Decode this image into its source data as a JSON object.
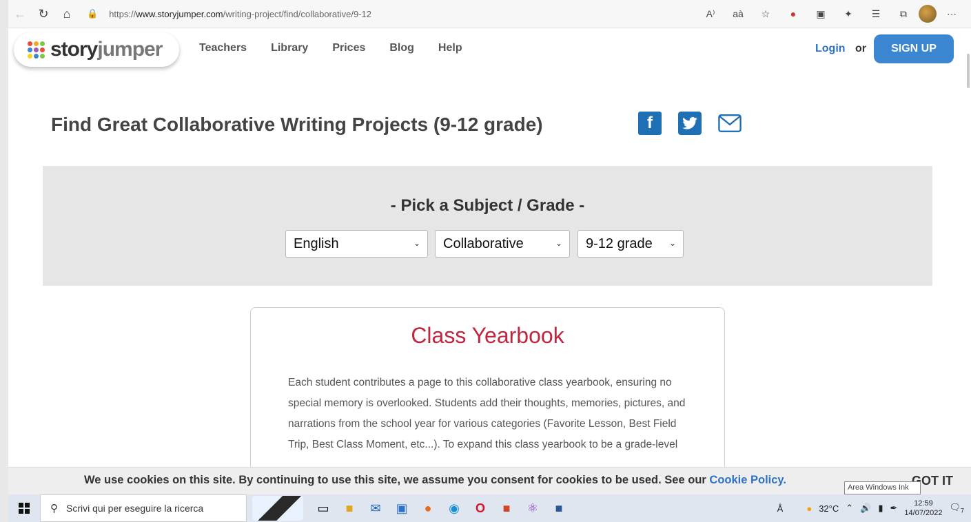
{
  "browser": {
    "url_prefix": "https://",
    "url_host": "www.storyjumper.com",
    "url_path": "/writing-project/find/collaborative/9-12",
    "read_aloud_label": "A⁾",
    "translate_label": "aà"
  },
  "nav": {
    "logo_story": "story",
    "logo_jumper": "jumper",
    "links": [
      "Teachers",
      "Library",
      "Prices",
      "Blog",
      "Help"
    ],
    "login": "Login",
    "or": "or",
    "signup": "SIGN UP"
  },
  "page": {
    "title": "Find Great Collaborative Writing Projects (9-12 grade)",
    "share_facebook": "f"
  },
  "picker": {
    "heading": "- Pick a Subject / Grade -",
    "subject": "English",
    "type": "Collaborative",
    "grade": "9-12 grade"
  },
  "card": {
    "title": "Class Yearbook",
    "description": "Each student contributes a page to this collaborative class yearbook, ensuring no special memory is overlooked. Students add their thoughts, memories, pictures, and narrations from the school year for various categories (Favorite Lesson, Best Field Trip, Best Class Moment, etc...). To expand this class yearbook to be a grade-level"
  },
  "cookie": {
    "message": "We use cookies on this site. By continuing to use this site, we assume you consent for cookies to be used. See our ",
    "policy_link": "Cookie Policy.",
    "got_it": "GOT IT",
    "tooltip": "Area Windows Ink"
  },
  "taskbar": {
    "search_placeholder": "Scrivi qui per eseguire la ricerca",
    "weather": "32°C",
    "time": "12:59",
    "date": "14/07/2022",
    "notification_count": "7"
  },
  "colors": {
    "brand_blue": "#3b86d0",
    "link_blue": "#2d72c6",
    "card_title": "#c0263f",
    "facebook": "#1f6fb5"
  }
}
